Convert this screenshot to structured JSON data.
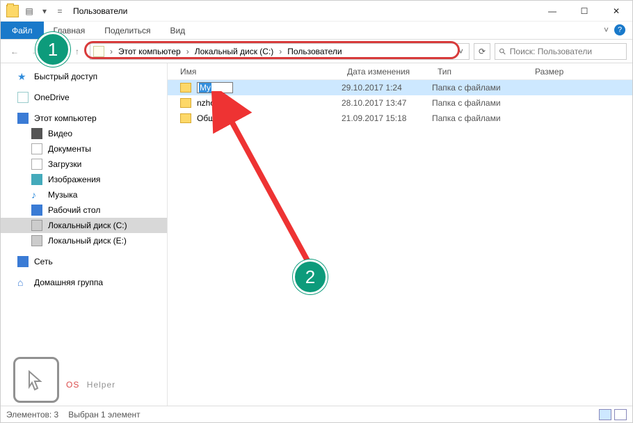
{
  "titlebar": {
    "title": "Пользователи"
  },
  "ribbon": {
    "file": "Файл",
    "tabs": [
      "Главная",
      "Поделиться",
      "Вид"
    ]
  },
  "breadcrumb": {
    "parts": [
      "Этот компьютер",
      "Локальный диск (C:)",
      "Пользователи"
    ]
  },
  "search": {
    "placeholder": "Поиск: Пользователи"
  },
  "columns": {
    "name": "Имя",
    "date": "Дата изменения",
    "type": "Тип",
    "size": "Размер"
  },
  "rows": [
    {
      "name": "My",
      "date": "29.10.2017 1:24",
      "type": "Папка с файлами",
      "renaming": true,
      "selected": true
    },
    {
      "name": "nzhola",
      "date": "28.10.2017 13:47",
      "type": "Папка с файлами"
    },
    {
      "name": "Общие",
      "date": "21.09.2017 15:18",
      "type": "Папка с файлами"
    }
  ],
  "sidebar": {
    "quick": "Быстрый доступ",
    "onedrive": "OneDrive",
    "pc": "Этот компьютер",
    "pc_children": [
      "Видео",
      "Документы",
      "Загрузки",
      "Изображения",
      "Музыка",
      "Рабочий стол",
      "Локальный диск (C:)",
      "Локальный диск (E:)"
    ],
    "net": "Сеть",
    "homegroup": "Домашняя группа"
  },
  "status": {
    "count": "Элементов: 3",
    "sel": "Выбран 1 элемент"
  },
  "watermark": {
    "os": "OS",
    "helper": "Helper"
  },
  "badges": {
    "b1": "1",
    "b2": "2"
  }
}
